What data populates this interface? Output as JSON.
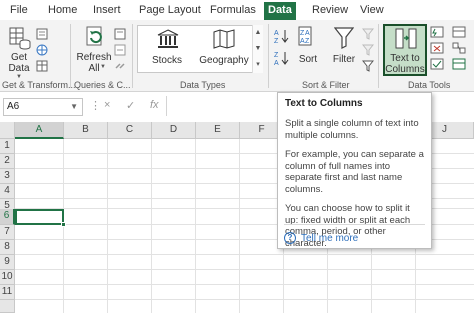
{
  "tabs": [
    {
      "label": "File",
      "active": false
    },
    {
      "label": "Home",
      "active": false
    },
    {
      "label": "Insert",
      "active": false
    },
    {
      "label": "Page Layout",
      "active": false
    },
    {
      "label": "Formulas",
      "active": false
    },
    {
      "label": "Data",
      "active": true
    },
    {
      "label": "Review",
      "active": false
    },
    {
      "label": "View",
      "active": false
    }
  ],
  "ribbon": {
    "get_data": {
      "line1": "Get",
      "line2": "Data"
    },
    "refresh_all": {
      "line1": "Refresh",
      "line2": "All"
    },
    "stocks": "Stocks",
    "geography": "Geography",
    "sort": "Sort",
    "filter": "Filter",
    "text_to_columns": {
      "line1": "Text to",
      "line2": "Columns"
    },
    "groups": {
      "get_transform": "Get & Transform...",
      "queries": "Queries & C...",
      "data_types": "Data Types",
      "sort_filter": "Sort & Filter",
      "data_tools": "Data Tools"
    }
  },
  "formula_bar": {
    "name_box": "A6",
    "cancel_icon": "×",
    "enter_icon": "✓",
    "fx": "fx",
    "formula": ""
  },
  "grid": {
    "columns": [
      "A",
      "B",
      "C",
      "D",
      "E",
      "F",
      "G",
      "H",
      "I",
      "J"
    ],
    "rows": [
      "1",
      "2",
      "3",
      "4",
      "5",
      "6",
      "7",
      "8",
      "9",
      "10",
      "11"
    ],
    "active_cell": "A6"
  },
  "tooltip": {
    "title": "Text to Columns",
    "p1": "Split a single column of text into multiple columns.",
    "p2": "For example, you can separate a column of full names into separate first and last name columns.",
    "p3": "You can choose how to split it up: fixed width or split at each comma, period, or other character.",
    "help": "Tell me more"
  },
  "colors": {
    "accent": "#217346",
    "link": "#2e6fbb"
  }
}
